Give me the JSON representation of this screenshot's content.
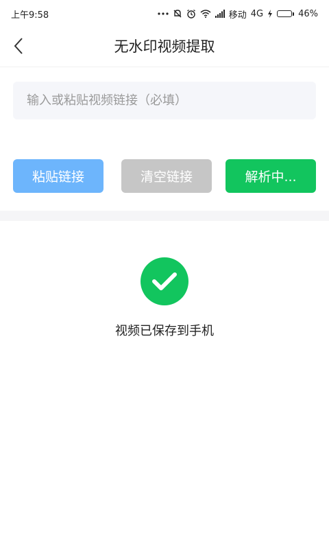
{
  "status_bar": {
    "time": "上午9:58",
    "carrier": "移动",
    "network": "4G",
    "battery": "46%",
    "battery_level": 0.46,
    "icons": [
      "more-dots-icon",
      "mute-icon",
      "alarm-icon",
      "wifi-icon",
      "signal-icon",
      "charging-icon",
      "battery-icon"
    ]
  },
  "header": {
    "back_icon": "chevron-left-icon",
    "title": "无水印视频提取"
  },
  "input": {
    "placeholder": "输入或粘贴视频链接（必填）",
    "value": ""
  },
  "buttons": {
    "paste_label": "粘贴链接",
    "clear_label": "清空链接",
    "parse_label": "解析中..."
  },
  "result": {
    "icon": "check-circle-icon",
    "message": "视频已保存到手机"
  },
  "colors": {
    "paste": "#6db5fc",
    "clear": "#c6c6c6",
    "primary_green": "#12c55e",
    "input_bg": "#f5f6fa"
  }
}
